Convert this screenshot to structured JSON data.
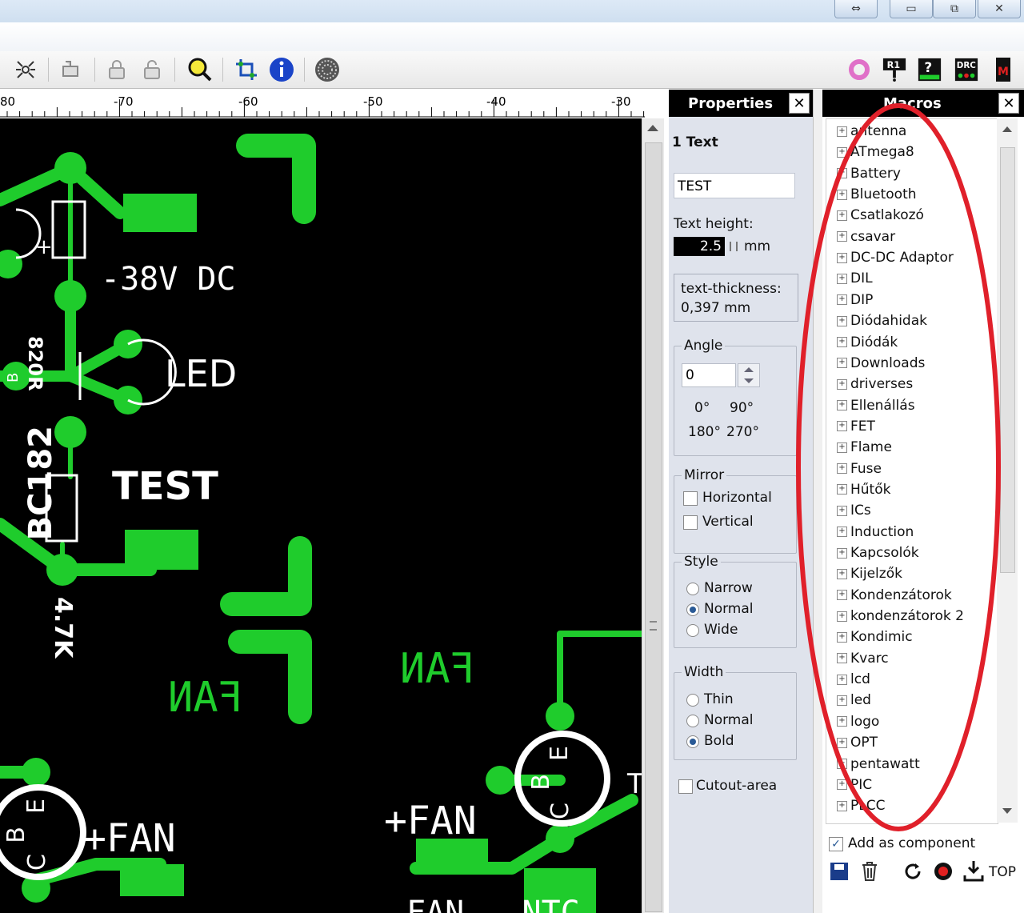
{
  "ruler": {
    "labels": [
      "80",
      "-70",
      "-60",
      "-50",
      "-40",
      "-30"
    ]
  },
  "canvas": {
    "labels": {
      "voltage": "-38V DC",
      "resistor_820": "820R",
      "transistor": "BC182",
      "b_marker": "B",
      "led": "LED",
      "test": "TEST",
      "resistor_47": "4.7K",
      "fan_mirror_1": "FAN",
      "fan_mirror_2": "FAN",
      "plus_fan_left": "+FAN",
      "plus_fan_right": "+FAN",
      "pin_c": "C",
      "pin_b": "B",
      "pin_e": "E",
      "pin_t": "T",
      "bottom_text": "FAN   NTC",
      "plus_sign": "+"
    }
  },
  "properties": {
    "title": "Properties",
    "close": "✕",
    "heading": "1 Text",
    "text_value": "TEST",
    "text_height_label": "Text height:",
    "text_height_value": "2.5",
    "text_height_unit": "mm",
    "thickness_line1": "text-thickness:",
    "thickness_line2": "0,397 mm",
    "angle_label": "Angle",
    "angle_value": "0",
    "angle_presets": [
      "0°",
      "90°",
      "180°",
      "270°"
    ],
    "mirror_label": "Mirror",
    "mirror_horizontal": "Horizontal",
    "mirror_vertical": "Vertical",
    "style_label": "Style",
    "style_options": [
      "Narrow",
      "Normal",
      "Wide"
    ],
    "style_selected": "Normal",
    "width_label": "Width",
    "width_options": [
      "Thin",
      "Normal",
      "Bold"
    ],
    "width_selected": "Bold",
    "cutout_label": "Cutout-area"
  },
  "macros": {
    "title": "Macros",
    "close": "✕",
    "items": [
      "antenna",
      "ATmega8",
      "Battery",
      "Bluetooth",
      "Csatlakozó",
      "csavar",
      "DC-DC Adaptor",
      "DIL",
      "DIP",
      "Diódahidak",
      "Diódák",
      "Downloads",
      "driverses",
      "Ellenállás",
      "FET",
      "Flame",
      "Fuse",
      "Hűtők",
      "ICs",
      "Induction",
      "Kapcsolók",
      "Kijelzők",
      "Kondenzátorok",
      "kondenzátorok 2",
      "Kondimic",
      "Kvarc",
      "lcd",
      "led",
      "logo",
      "OPT",
      "pentawatt",
      "PIC",
      "PLCC"
    ],
    "add_as_component": "Add as component",
    "add_checked": true,
    "top_label": "TOP"
  },
  "toolbar_icons": [
    "autoroute-icon",
    "pcb-tool-icon",
    "lock-icon",
    "unlock-icon",
    "zoom-icon",
    "crop-icon",
    "info-icon",
    "pattern-icon",
    "ring-icon",
    "r1-icon",
    "help-icon",
    "drc-icon",
    "m-icon"
  ],
  "colors": {
    "copper": "#1fcc2c",
    "board": "#000000",
    "annotation": "#e0202a"
  }
}
